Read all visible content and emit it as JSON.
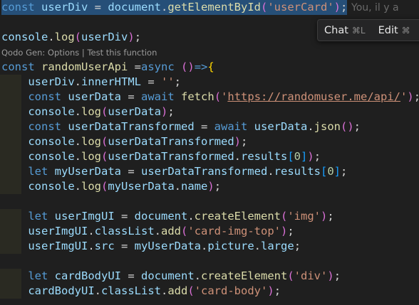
{
  "editor": {
    "git_blame": "You, il y a",
    "codelens": {
      "prefix": "Qodo Gen: ",
      "options": "Options",
      "separator": " | ",
      "test": "Test this function"
    },
    "lines": [
      [
        [
          "kw",
          "const"
        ],
        [
          "plain",
          " "
        ],
        [
          "var",
          "userDiv"
        ],
        [
          "plain",
          " = "
        ],
        [
          "var",
          "document"
        ],
        [
          "plain",
          "."
        ],
        [
          "fn",
          "getElementById"
        ],
        [
          "paren",
          "("
        ],
        [
          "str",
          "'userCard'"
        ],
        [
          "paren",
          ")"
        ],
        [
          "plain",
          ";"
        ]
      ],
      [],
      [
        [
          "var",
          "console"
        ],
        [
          "plain",
          "."
        ],
        [
          "fn",
          "log"
        ],
        [
          "paren",
          "("
        ],
        [
          "var",
          "userDiv"
        ],
        [
          "paren",
          ")"
        ],
        [
          "plain",
          ";"
        ]
      ],
      [
        [
          "kw",
          "const"
        ],
        [
          "plain",
          " "
        ],
        [
          "fn",
          "randomUserApi"
        ],
        [
          "plain",
          " ="
        ],
        [
          "kw",
          "async"
        ],
        [
          "plain",
          " "
        ],
        [
          "paren",
          "()"
        ],
        [
          "kw",
          "=>"
        ],
        [
          "brace",
          "{"
        ]
      ],
      [
        [
          "plain",
          "    "
        ],
        [
          "var",
          "userDiv"
        ],
        [
          "plain",
          "."
        ],
        [
          "var",
          "innerHTML"
        ],
        [
          "plain",
          " = "
        ],
        [
          "str",
          "''"
        ],
        [
          "plain",
          ";"
        ]
      ],
      [
        [
          "plain",
          "    "
        ],
        [
          "kw",
          "const"
        ],
        [
          "plain",
          " "
        ],
        [
          "var",
          "userData"
        ],
        [
          "plain",
          " = "
        ],
        [
          "kw",
          "await"
        ],
        [
          "plain",
          " "
        ],
        [
          "fn",
          "fetch"
        ],
        [
          "paren",
          "("
        ],
        [
          "str",
          "'"
        ],
        [
          "url",
          "https://randomuser.me/api/"
        ],
        [
          "str",
          "'"
        ],
        [
          "paren",
          ")"
        ],
        [
          "plain",
          ";"
        ]
      ],
      [
        [
          "plain",
          "    "
        ],
        [
          "var",
          "console"
        ],
        [
          "plain",
          "."
        ],
        [
          "fn",
          "log"
        ],
        [
          "paren",
          "("
        ],
        [
          "var",
          "userData"
        ],
        [
          "paren",
          ")"
        ],
        [
          "plain",
          ";"
        ]
      ],
      [
        [
          "plain",
          "    "
        ],
        [
          "kw",
          "const"
        ],
        [
          "plain",
          " "
        ],
        [
          "var",
          "userDataTransformed"
        ],
        [
          "plain",
          " = "
        ],
        [
          "kw",
          "await"
        ],
        [
          "plain",
          " "
        ],
        [
          "var",
          "userData"
        ],
        [
          "plain",
          "."
        ],
        [
          "fn",
          "json"
        ],
        [
          "paren",
          "()"
        ],
        [
          "plain",
          ";"
        ]
      ],
      [
        [
          "plain",
          "    "
        ],
        [
          "var",
          "console"
        ],
        [
          "plain",
          "."
        ],
        [
          "fn",
          "log"
        ],
        [
          "paren",
          "("
        ],
        [
          "var",
          "userDataTransformed"
        ],
        [
          "paren",
          ")"
        ],
        [
          "plain",
          ";"
        ]
      ],
      [
        [
          "plain",
          "    "
        ],
        [
          "var",
          "console"
        ],
        [
          "plain",
          "."
        ],
        [
          "fn",
          "log"
        ],
        [
          "paren",
          "("
        ],
        [
          "var",
          "userDataTransformed"
        ],
        [
          "plain",
          "."
        ],
        [
          "var",
          "results"
        ],
        [
          "bracket",
          "["
        ],
        [
          "num",
          "0"
        ],
        [
          "bracket",
          "]"
        ],
        [
          "paren",
          ")"
        ],
        [
          "plain",
          ";"
        ]
      ],
      [
        [
          "plain",
          "    "
        ],
        [
          "kw",
          "let"
        ],
        [
          "plain",
          " "
        ],
        [
          "var",
          "myUserData"
        ],
        [
          "plain",
          " = "
        ],
        [
          "var",
          "userDataTransformed"
        ],
        [
          "plain",
          "."
        ],
        [
          "var",
          "results"
        ],
        [
          "bracket",
          "["
        ],
        [
          "num",
          "0"
        ],
        [
          "bracket",
          "]"
        ],
        [
          "plain",
          ";"
        ]
      ],
      [
        [
          "plain",
          "    "
        ],
        [
          "var",
          "console"
        ],
        [
          "plain",
          "."
        ],
        [
          "fn",
          "log"
        ],
        [
          "paren",
          "("
        ],
        [
          "var",
          "myUserData"
        ],
        [
          "plain",
          "."
        ],
        [
          "var",
          "name"
        ],
        [
          "paren",
          ")"
        ],
        [
          "plain",
          ";"
        ]
      ],
      [],
      [
        [
          "plain",
          "    "
        ],
        [
          "kw",
          "let"
        ],
        [
          "plain",
          " "
        ],
        [
          "var",
          "userImgUI"
        ],
        [
          "plain",
          " = "
        ],
        [
          "var",
          "document"
        ],
        [
          "plain",
          "."
        ],
        [
          "fn",
          "createElement"
        ],
        [
          "paren",
          "("
        ],
        [
          "str",
          "'img'"
        ],
        [
          "paren",
          ")"
        ],
        [
          "plain",
          ";"
        ]
      ],
      [
        [
          "plain",
          "    "
        ],
        [
          "var",
          "userImgUI"
        ],
        [
          "plain",
          "."
        ],
        [
          "var",
          "classList"
        ],
        [
          "plain",
          "."
        ],
        [
          "fn",
          "add"
        ],
        [
          "paren",
          "("
        ],
        [
          "str",
          "'card-img-top'"
        ],
        [
          "paren",
          ")"
        ],
        [
          "plain",
          ";"
        ]
      ],
      [
        [
          "plain",
          "    "
        ],
        [
          "var",
          "userImgUI"
        ],
        [
          "plain",
          "."
        ],
        [
          "var",
          "src"
        ],
        [
          "plain",
          " = "
        ],
        [
          "var",
          "myUserData"
        ],
        [
          "plain",
          "."
        ],
        [
          "var",
          "picture"
        ],
        [
          "plain",
          "."
        ],
        [
          "var",
          "large"
        ],
        [
          "plain",
          ";"
        ]
      ],
      [],
      [
        [
          "plain",
          "    "
        ],
        [
          "kw",
          "let"
        ],
        [
          "plain",
          " "
        ],
        [
          "var",
          "cardBodyUI"
        ],
        [
          "plain",
          " = "
        ],
        [
          "var",
          "document"
        ],
        [
          "plain",
          "."
        ],
        [
          "fn",
          "createElement"
        ],
        [
          "paren",
          "("
        ],
        [
          "str",
          "'div'"
        ],
        [
          "paren",
          ")"
        ],
        [
          "plain",
          ";"
        ]
      ],
      [
        [
          "plain",
          "    "
        ],
        [
          "var",
          "cardBodyUI"
        ],
        [
          "plain",
          "."
        ],
        [
          "var",
          "classList"
        ],
        [
          "plain",
          "."
        ],
        [
          "fn",
          "add"
        ],
        [
          "paren",
          "("
        ],
        [
          "str",
          "'card-body'"
        ],
        [
          "paren",
          ")"
        ],
        [
          "plain",
          ";"
        ]
      ]
    ]
  },
  "popup": {
    "chat_label": "Chat",
    "chat_shortcut": "⌘L",
    "edit_label": "Edit",
    "edit_shortcut": "⌘"
  },
  "colors": {
    "background": "#1f1f1f",
    "selection": "#264f78",
    "keyword": "#569cd6",
    "variable": "#9cdcfe",
    "function": "#dcdcaa",
    "string": "#ce9178"
  }
}
